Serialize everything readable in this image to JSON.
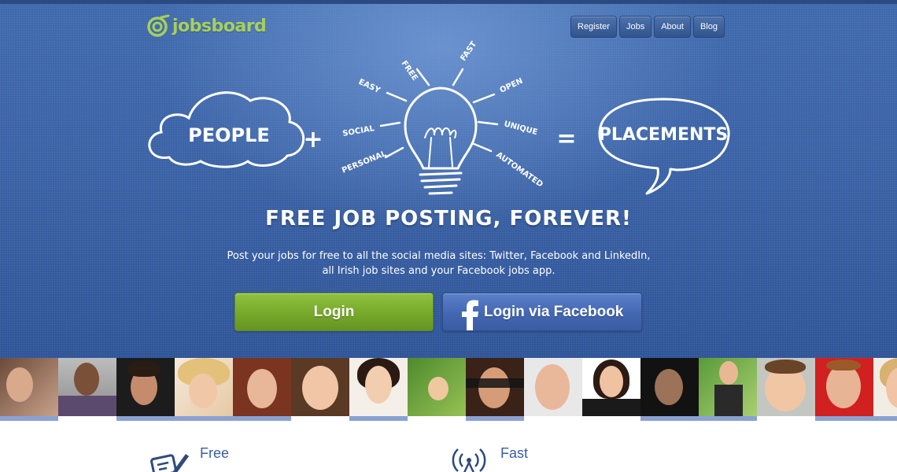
{
  "logo": {
    "prefix": "jobs",
    "suffix": "board"
  },
  "nav": [
    {
      "label": "Register"
    },
    {
      "label": "Jobs"
    },
    {
      "label": "About"
    },
    {
      "label": "Blog"
    }
  ],
  "illustration": {
    "left_word": "PEOPLE",
    "plus": "+",
    "equals": "=",
    "right_word": "PLACEMENTS",
    "rays": [
      "FREE",
      "FAST",
      "EASY",
      "OPEN",
      "SOCIAL",
      "UNIQUE",
      "PERSONAL",
      "AUTOMATED"
    ]
  },
  "headline": "FREE JOB POSTING, FOREVER!",
  "subtext_line1": "Post your jobs for free to all the social media sites: Twitter, Facebook and LinkedIn,",
  "subtext_line2": "all Irish job sites and your Facebook jobs app.",
  "buttons": {
    "login": "Login",
    "facebook": "Login via Facebook"
  },
  "features": [
    {
      "title": "Free",
      "icon": "pencil-paper-icon"
    },
    {
      "title": "Fast",
      "icon": "broadcast-tower-icon"
    }
  ],
  "colors": {
    "hero_blue": "#3a62a6",
    "accent_green": "#76a92a",
    "facebook_blue": "#4367b2",
    "strip_bar": "#8aa2d2"
  }
}
